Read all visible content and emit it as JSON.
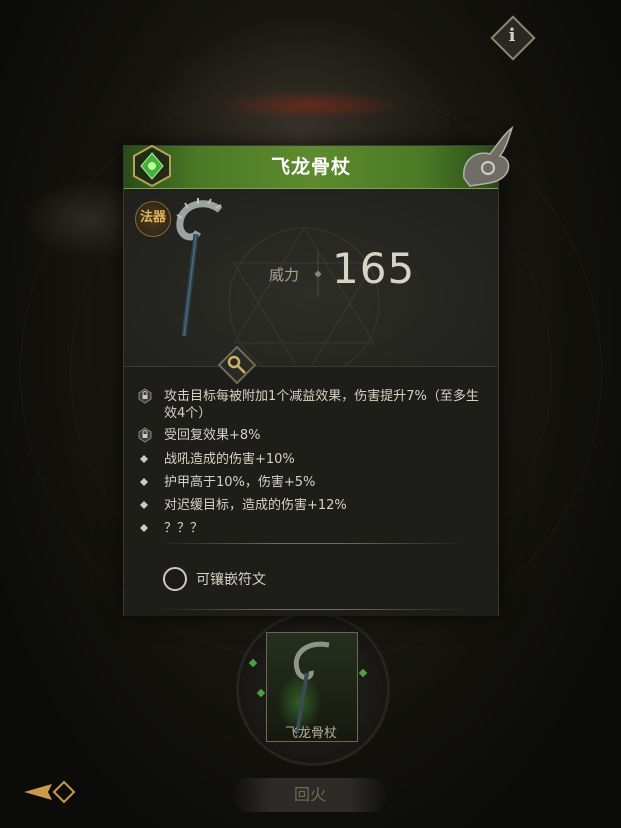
{
  "item": {
    "name": "飞龙骨杖",
    "category": "法器",
    "power_label": "威力",
    "power_value": "165"
  },
  "attributes": [
    {
      "type": "locked",
      "text": "攻击目标每被附加1个减益效果，伤害提升7%（至多生效4个）"
    },
    {
      "type": "locked",
      "text": "受回复效果+8%"
    },
    {
      "type": "bullet",
      "text": "战吼造成的伤害+10%"
    },
    {
      "type": "bullet",
      "text": "护甲高于10%，伤害+5%"
    },
    {
      "type": "bullet",
      "text": "对迟缓目标，造成的伤害+12%"
    },
    {
      "type": "bullet",
      "text": "？？？"
    }
  ],
  "socket": {
    "label": "可镶嵌符文"
  },
  "slot": {
    "name": "飞龙骨杖"
  },
  "bottom": {
    "fire_button": "回火"
  },
  "info": {
    "glyph": "i"
  },
  "colors": {
    "header_green": "#4a7a25",
    "category_gold": "#e2b45d",
    "text": "#d6d2c5"
  }
}
